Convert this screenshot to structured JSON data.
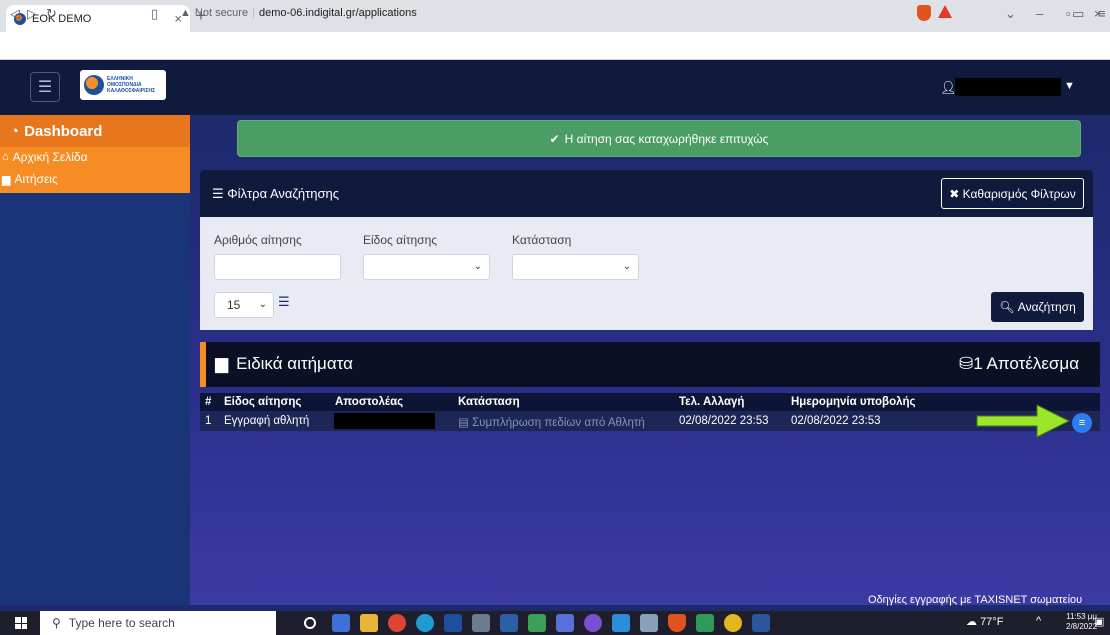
{
  "browser": {
    "tab_title": "EOK DEMO",
    "tab_close": "×",
    "new_tab": "+",
    "security_label": "Not secure",
    "url": "demo-06.indigital.gr/applications"
  },
  "app": {
    "logo_text_1": "ΕΛΛΗΝΙΚΗ",
    "logo_text_2": "ΟΜΟΣΠΟΝΔΙΑ",
    "logo_text_3": "ΚΑΛΑΘΟΣΦΑΙΡΙΣΗΣ"
  },
  "sidebar": {
    "dashboard": "Dashboard",
    "items": [
      {
        "label": "Αρχική Σελίδα",
        "icon": "home-icon"
      },
      {
        "label": "Αιτήσεις",
        "icon": "archive-icon"
      }
    ]
  },
  "alert": {
    "message": "Η αίτηση σας καταχωρήθηκε επιτυχώς"
  },
  "filters": {
    "title": "Φίλτρα Αναζήτησης",
    "clear_label": "Καθαρισμός Φίλτρων",
    "application_number_label": "Αριθμός αίτησης",
    "application_type_label": "Είδος αίτησης",
    "status_label": "Κατάσταση",
    "page_size": "15",
    "search_label": "Αναζήτηση"
  },
  "requests": {
    "title": "Ειδικά αιτήματα",
    "count_label": "1 Αποτέλεσμα",
    "columns": [
      "#",
      "Είδος αίτησης",
      "Αποστολέας",
      "Κατάσταση",
      "Τελ. Αλλαγή",
      "Ημερομηνία υποβολής"
    ],
    "rows": [
      {
        "num": "1",
        "type": "Εγγραφή αθλητή",
        "status": "Συμπλήρωση πεδίων από Αθλητή",
        "last_change": "02/08/2022 23:53",
        "submitted": "02/08/2022 23:53"
      }
    ]
  },
  "footer": {
    "link": "Οδηγίες εγγραφής με TAXISNET σωματείου"
  },
  "taskbar": {
    "search_placeholder": "Type here to search",
    "weather": "77°F",
    "time": "11:53 μμ",
    "date": "2/8/2022"
  },
  "colors": {
    "orange": "#f58d24",
    "dark_navy": "#0f1a3d",
    "success": "#4b9e63",
    "accent_blue": "#2f7bf0"
  }
}
